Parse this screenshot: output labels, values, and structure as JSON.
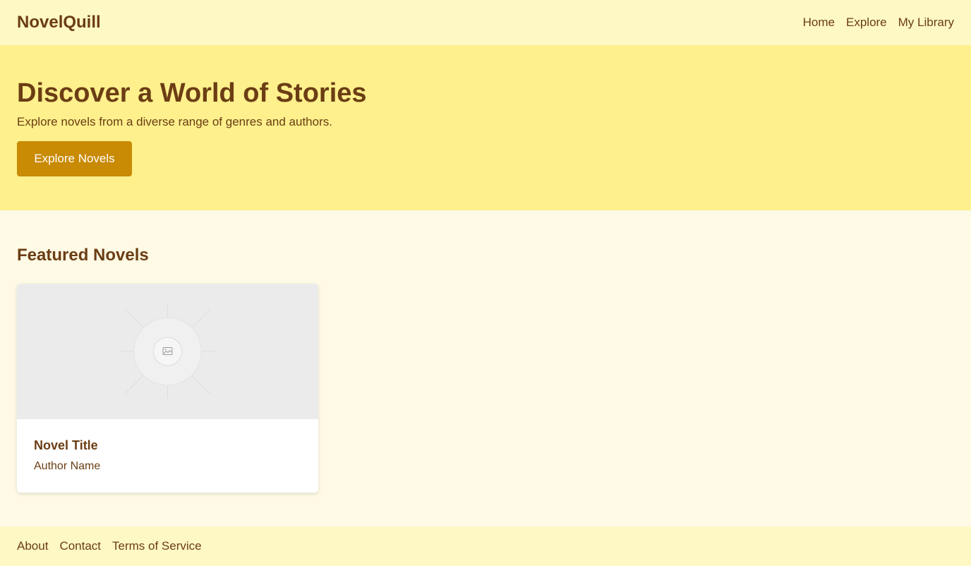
{
  "header": {
    "brand": "NovelQuill",
    "nav": [
      {
        "label": "Home"
      },
      {
        "label": "Explore"
      },
      {
        "label": "My Library"
      }
    ]
  },
  "hero": {
    "title": "Discover a World of Stories",
    "subtitle": "Explore novels from a diverse range of genres and authors.",
    "cta_label": "Explore Novels"
  },
  "featured": {
    "heading": "Featured Novels",
    "cards": [
      {
        "title": "Novel Title",
        "author": "Author Name",
        "cover_icon": "image-placeholder-icon"
      }
    ]
  },
  "footer": {
    "links": [
      {
        "label": "About"
      },
      {
        "label": "Contact"
      },
      {
        "label": "Terms of Service"
      }
    ]
  },
  "colors": {
    "header_bg": "#fef8c4",
    "hero_bg": "#fef08c",
    "page_bg": "#fefae5",
    "accent": "#c98a04",
    "text": "#6b3d14"
  }
}
